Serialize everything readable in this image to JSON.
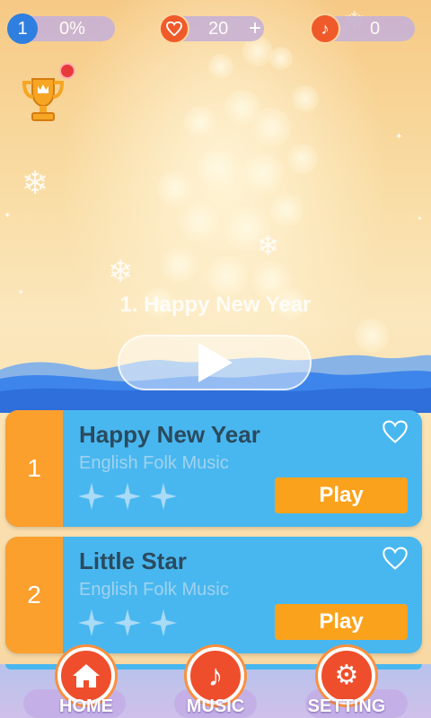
{
  "topbar": {
    "level_number": "1",
    "progress": "0%",
    "lives": "20",
    "add_symbol": "+",
    "notes_count": "0"
  },
  "featured": {
    "title": "1. Happy New Year"
  },
  "songs": [
    {
      "number": "1",
      "name": "Happy New Year",
      "genre": "English Folk Music",
      "stars": 3,
      "play_label": "Play"
    },
    {
      "number": "2",
      "name": "Little Star",
      "genre": "English Folk Music",
      "stars": 3,
      "play_label": "Play"
    }
  ],
  "nav": {
    "home_label": "HOME",
    "music_label": "MUSIC",
    "setting_label": "SETTING"
  },
  "colors": {
    "card_blue": "#49b7ef",
    "number_orange": "#fb9f2d",
    "play_orange": "#fba21c",
    "nav_red": "#ef4e2c"
  }
}
